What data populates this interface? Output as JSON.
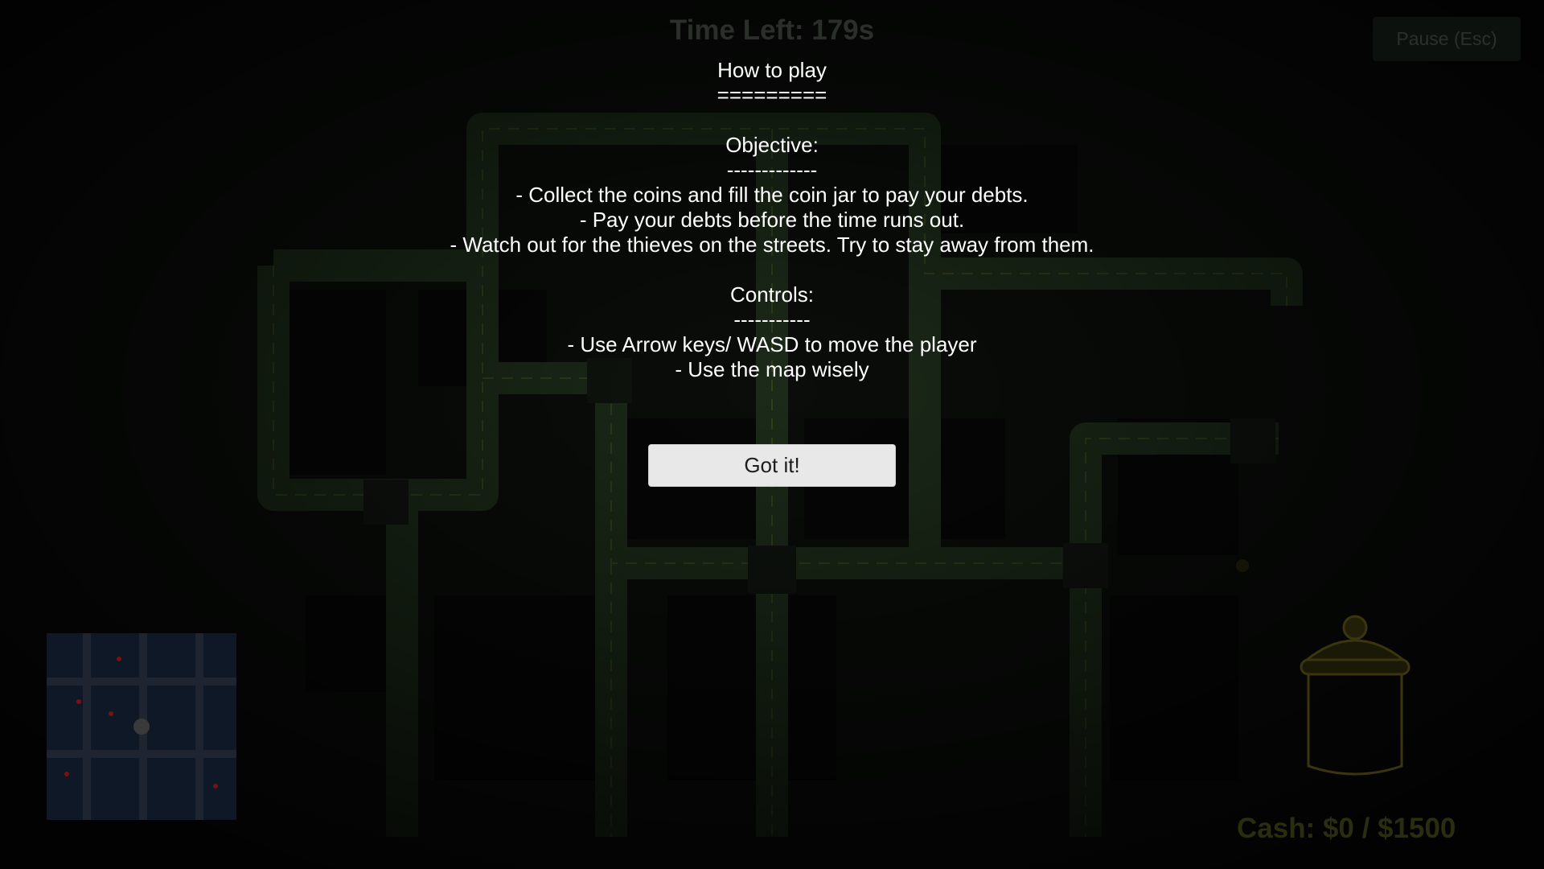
{
  "hud": {
    "time_left": "Time Left: 179s",
    "pause_label": "Pause (Esc)",
    "cash": "Cash: $0 / $1500"
  },
  "how_to_play": {
    "title": "How to play",
    "title_underline": "=========",
    "objective_heading": "Objective:",
    "objective_underline": "-------------",
    "objective_lines": [
      "- Collect the coins and fill the coin jar to pay your debts.",
      "- Pay your debts before the time runs out.",
      "- Watch out for the thieves on the streets. Try to stay away from them."
    ],
    "controls_heading": "Controls:",
    "controls_underline": "-----------",
    "controls_lines": [
      "- Use Arrow keys/ WASD to move the player",
      "- Use the map wisely"
    ],
    "confirm_label": "Got it!"
  },
  "colors": {
    "overlay_text": "#ffffff",
    "road_glow": "#2f4a2a",
    "jar_outline": "#3a3510",
    "minimap_bg": "#0f1826",
    "thief_dot": "#7a1010"
  },
  "icons": {
    "coin_jar": "coin-jar-icon",
    "player_marker": "player-dot-icon",
    "thief_marker": "thief-dot-icon"
  }
}
